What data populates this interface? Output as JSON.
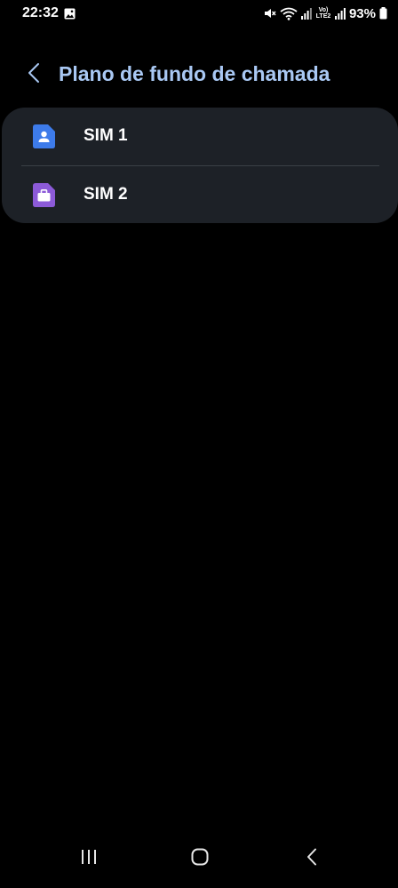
{
  "status_bar": {
    "time": "22:32",
    "battery_percent": "93%",
    "network_label_top": "Vo)",
    "network_label_bottom": "LTE2",
    "icons": [
      "gallery-icon",
      "mute-icon",
      "wifi-icon",
      "signal-icon",
      "signal-icon",
      "battery-icon"
    ]
  },
  "header": {
    "title": "Plano de fundo de chamada",
    "back_icon": "chevron-left-icon"
  },
  "list": {
    "items": [
      {
        "label": "SIM 1",
        "icon": "sim-person-icon",
        "icon_color": "#3d7bea"
      },
      {
        "label": "SIM 2",
        "icon": "sim-briefcase-icon",
        "icon_color": "#8c5ad8"
      }
    ]
  },
  "nav_bar": {
    "icons": [
      "recents-icon",
      "home-icon",
      "back-icon"
    ]
  },
  "colors": {
    "background": "#000000",
    "card": "#1d2127",
    "title": "#a9c8f3"
  }
}
